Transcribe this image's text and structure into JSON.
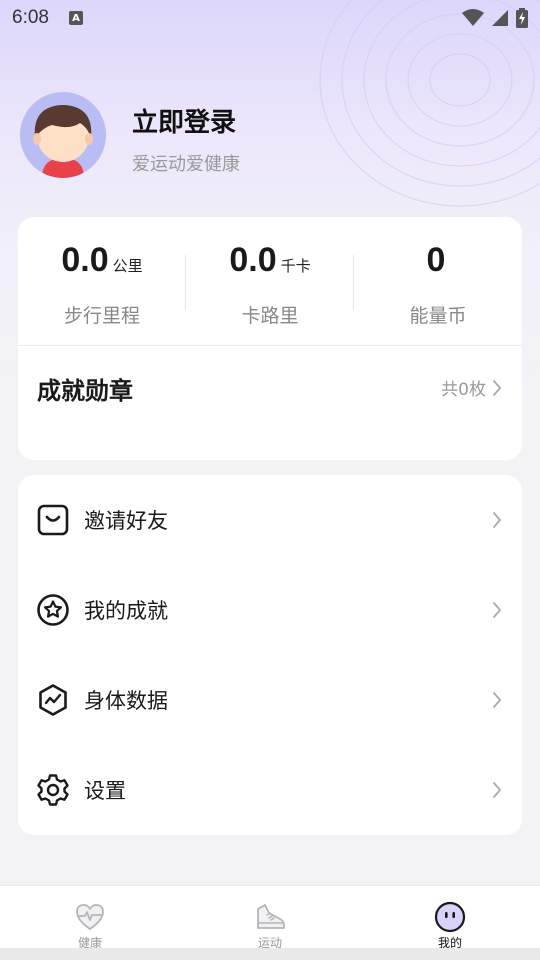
{
  "status_bar": {
    "time": "6:08",
    "notification_letter": "A"
  },
  "profile": {
    "title": "立即登录",
    "subtitle": "爱运动爱健康"
  },
  "stats": [
    {
      "value": "0.0",
      "unit": "公里",
      "label": "步行里程"
    },
    {
      "value": "0.0",
      "unit": "千卡",
      "label": "卡路里"
    },
    {
      "value": "0",
      "unit": "",
      "label": "能量币"
    }
  ],
  "medals": {
    "title": "成就勋章",
    "count": "共0枚"
  },
  "menu": [
    {
      "label": "邀请好友",
      "icon": "invite-icon"
    },
    {
      "label": "我的成就",
      "icon": "star-badge-icon"
    },
    {
      "label": "身体数据",
      "icon": "body-data-icon"
    },
    {
      "label": "设置",
      "icon": "gear-icon"
    }
  ],
  "tabs": [
    {
      "label": "健康",
      "icon": "heart-pulse-icon",
      "active": false
    },
    {
      "label": "运动",
      "icon": "sneaker-icon",
      "active": false
    },
    {
      "label": "我的",
      "icon": "face-icon",
      "active": true
    }
  ],
  "colors": {
    "accent": "#d9d2fb",
    "avatar_bg": "#b9bdf4",
    "active_tab": "#111111"
  }
}
